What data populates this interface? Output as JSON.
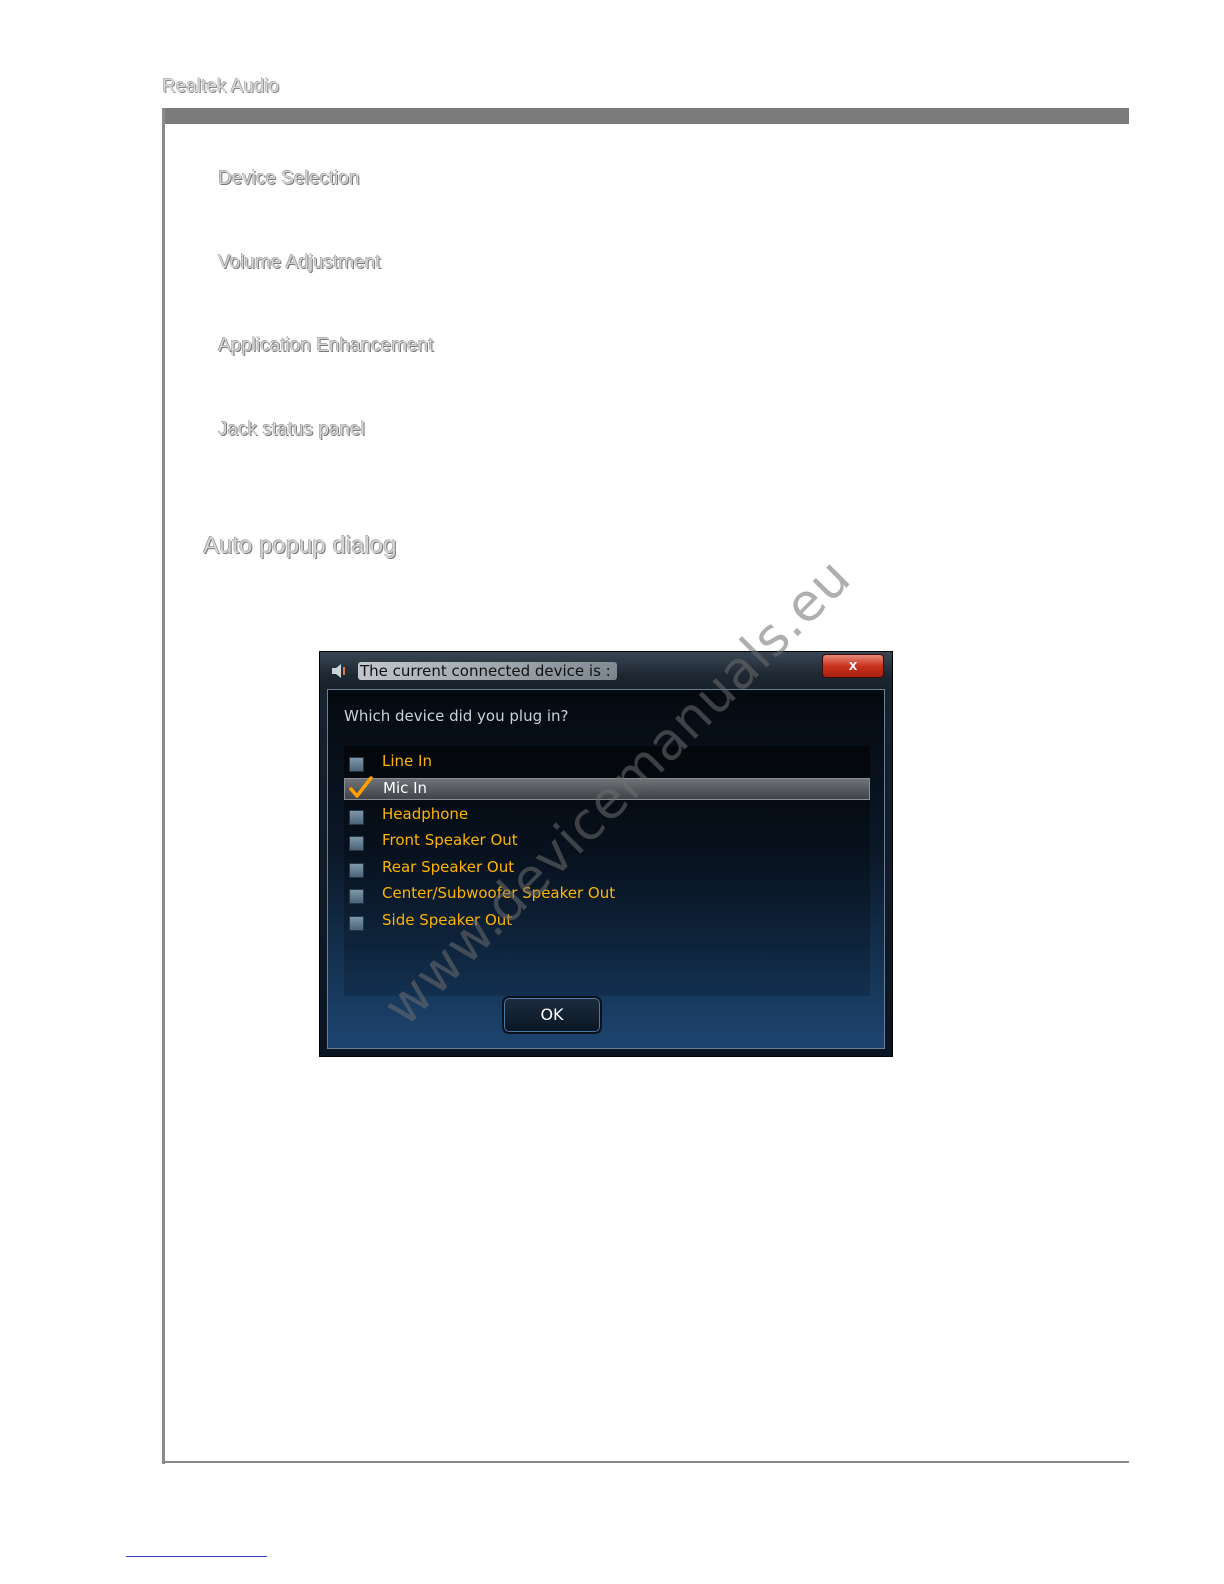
{
  "header": {
    "title": "Realtek Audio"
  },
  "sections": [
    {
      "heading": "Device Selection"
    },
    {
      "heading": "Volume Adjustment"
    },
    {
      "heading": "Application Enhancement"
    },
    {
      "heading": "Jack status panel"
    }
  ],
  "auto_popup": {
    "heading": "Auto popup dialog"
  },
  "dialog": {
    "title": "The current connected device is :",
    "close_label": "x",
    "question": "Which device did you plug in?",
    "items": [
      {
        "label": "Line In",
        "checked": false
      },
      {
        "label": "Mic In",
        "checked": true
      },
      {
        "label": "Headphone",
        "checked": false
      },
      {
        "label": "Front Speaker Out",
        "checked": false
      },
      {
        "label": "Rear Speaker Out",
        "checked": false
      },
      {
        "label": "Center/Subwoofer Speaker Out",
        "checked": false
      },
      {
        "label": "Side Speaker Out",
        "checked": false
      }
    ],
    "ok_label": "OK"
  },
  "watermark": "www.devicemanuals.eu",
  "colors": {
    "item_text": "#ffb400",
    "selected_text": "#ffffff",
    "check": "#ffa000"
  }
}
